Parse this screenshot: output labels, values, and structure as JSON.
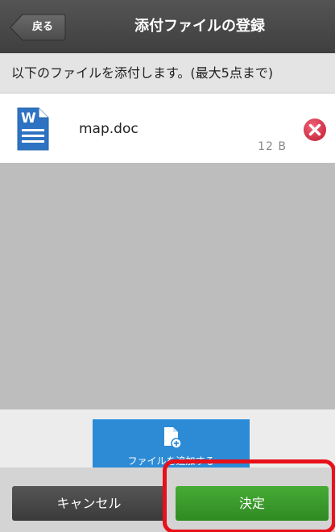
{
  "header": {
    "back_label": "戻る",
    "title": "添付ファイルの登録"
  },
  "info": {
    "text": "以下のファイルを添付します。(最大5点まで)"
  },
  "files": [
    {
      "name": "map.doc",
      "size": "12 B",
      "icon": "word-document-icon"
    }
  ],
  "actions": {
    "add_file_label": "ファイルを追加する",
    "cancel_label": "キャンセル",
    "confirm_label": "決定"
  },
  "colors": {
    "header_bg": "#4a4a4a",
    "add_button": "#2d8bd6",
    "confirm_button": "#3c9e2c",
    "cancel_button": "#484848",
    "highlight": "#e8101a",
    "remove_icon": "#d8334a",
    "word_icon": "#2e73c2"
  }
}
